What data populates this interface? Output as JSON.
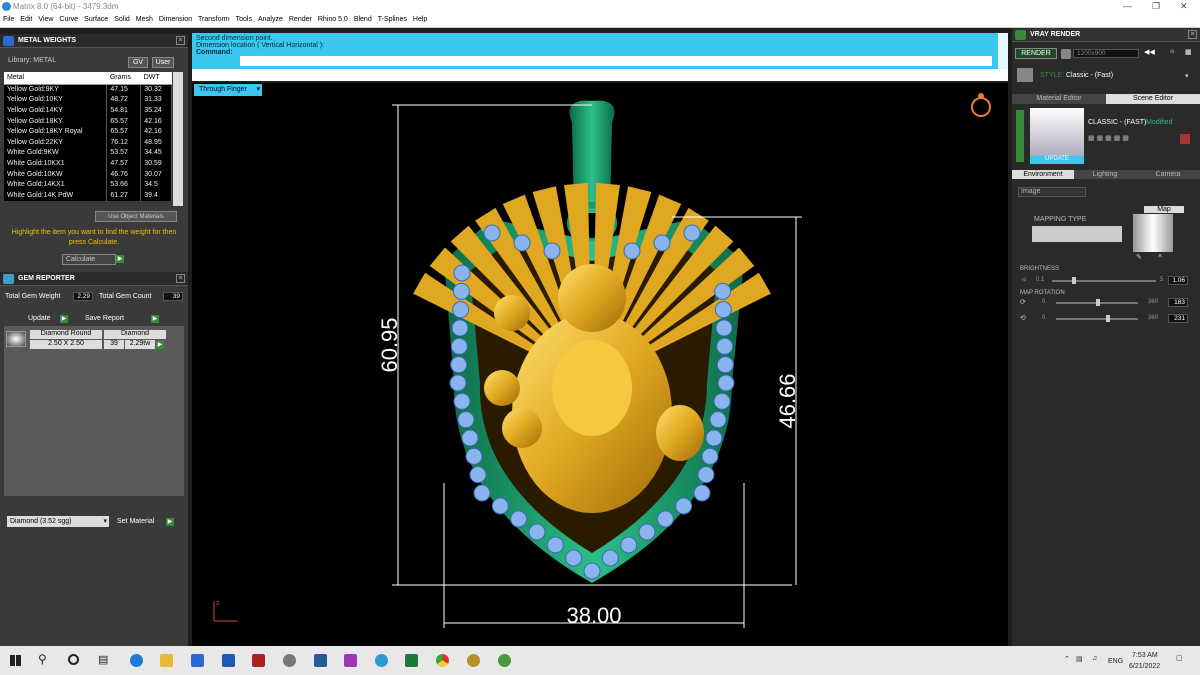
{
  "window": {
    "title": "Matrix 8.0 (64-bit) - 3479.3dm"
  },
  "menu": [
    "File",
    "Edit",
    "View",
    "Curve",
    "Surface",
    "Solid",
    "Mesh",
    "Dimension",
    "Transform",
    "Tools",
    "Analyze",
    "Render",
    "Rhino 5.0",
    "Blend",
    "T-Splines",
    "Help"
  ],
  "metal_weights": {
    "title": "METAL WEIGHTS",
    "library": "Library: METAL",
    "btn_gv": "GV",
    "btn_user": "User",
    "columns": [
      "Metal",
      "Grams",
      "DWT"
    ],
    "rows": [
      [
        "Yellow Gold:9KY",
        "47.15",
        "30.32"
      ],
      [
        "Yellow Gold:10KY",
        "48.72",
        "31.33"
      ],
      [
        "Yellow Gold:14KY",
        "54.81",
        "35.24"
      ],
      [
        "Yellow Gold:18KY",
        "65.57",
        "42.16"
      ],
      [
        "Yellow Gold:18KY Royal",
        "65.57",
        "42.16"
      ],
      [
        "Yellow Gold:22KY",
        "76.12",
        "48.95"
      ],
      [
        "White Gold:9KW",
        "53.57",
        "34.45"
      ],
      [
        "White Gold:10KX1",
        "47.57",
        "30.59"
      ],
      [
        "White Gold:10KW",
        "46.76",
        "30.07"
      ],
      [
        "White Gold:14KX1",
        "53.66",
        "34.5"
      ],
      [
        "White Gold:14K PdW",
        "61.27",
        "39.4"
      ]
    ],
    "use_object": "Use Object Materials",
    "hint": "Highlight the item you want to find the weight for then press Calculate.",
    "calculate": "Calculate"
  },
  "gem_reporter": {
    "title": "GEM REPORTER",
    "total_weight_label": "Total Gem Weight",
    "total_weight": "2.29",
    "total_count_label": "Total Gem Count",
    "total_count": "39",
    "update": "Update",
    "save_report": "Save Report",
    "gem": {
      "type": "Diamond Round",
      "size": "2.50 X 2.50",
      "material": "Diamond",
      "count": "39",
      "weight": "2.29tw"
    },
    "material_select": "Diamond   (3.52 sgg)",
    "set_material": "Set Material"
  },
  "command": {
    "line1": "Second dimension point.",
    "line2": "Dimension location ( Vertical  Horizontal ):",
    "label": "Command:"
  },
  "viewport": {
    "name": "Through Finger",
    "dims": {
      "height_total": "60.95",
      "height_body": "46.66",
      "width": "38.00"
    },
    "axis": "z"
  },
  "vray": {
    "title": "VRAY RENDER",
    "render": "RENDER",
    "resolution": "1200x900",
    "style_label": "STYLE:",
    "style": "Classic - (Fast)",
    "tabs": [
      "Material Editor",
      "Scene Editor"
    ],
    "preset": "CLASSIC - (FAST)",
    "modified": "Modified",
    "update": "UPDATE",
    "env_tabs": [
      "Environment",
      "Lighting",
      "Camera"
    ],
    "env_select": "Image",
    "mapping_type": "MAPPING TYPE",
    "map": "Map",
    "brightness": {
      "label": "BRIGHTNESS",
      "min": "0.1",
      "max": "5",
      "value": "1.06",
      "level": 0.2
    },
    "map_rotation": {
      "label": "MAP ROTATION",
      "min": "0",
      "max": "360",
      "h": "183",
      "v": "231",
      "h_level": 0.51,
      "v_level": 0.64
    }
  },
  "taskbar": {
    "lang": "ENG",
    "time": "7:53 AM",
    "date": "6/21/2022"
  },
  "colors": {
    "accent": "#3ac8ee",
    "metal": "#e0a820",
    "enamel": "#1a9a6a",
    "gem": "#8ab4ee"
  }
}
